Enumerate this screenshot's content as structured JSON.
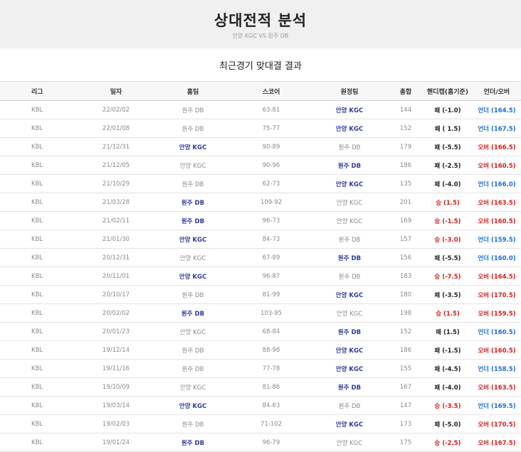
{
  "header": {
    "title": "상대전적 분석",
    "subtitle": "안양 KGC VS 원주 DB"
  },
  "section_title": "최근경기 맞대결 결과",
  "columns": [
    "리그",
    "일자",
    "홈팀",
    "스코어",
    "원정팀",
    "총합",
    "핸디캡(홈기준)",
    "언더/오버"
  ],
  "rows": [
    {
      "league": "KBL",
      "date": "22/02/02",
      "home": "원주 DB",
      "score": "63-81",
      "away": "안양 KGC",
      "total": "144",
      "handicap": "패 (-1.0)",
      "ou": "언더 (164.5)",
      "winner": "away",
      "hc": "l",
      "ou_type": "under"
    },
    {
      "league": "KBL",
      "date": "22/01/08",
      "home": "원주 DB",
      "score": "75-77",
      "away": "안양 KGC",
      "total": "152",
      "handicap": "패 ( 1.5)",
      "ou": "언더 (167.5)",
      "winner": "away",
      "hc": "l",
      "ou_type": "under"
    },
    {
      "league": "KBL",
      "date": "21/12/31",
      "home": "안양 KGC",
      "score": "90-89",
      "away": "원주 DB",
      "total": "179",
      "handicap": "패 (-5.5)",
      "ou": "오버 (166.5)",
      "winner": "home",
      "hc": "l",
      "ou_type": "over"
    },
    {
      "league": "KBL",
      "date": "21/12/05",
      "home": "안양 KGC",
      "score": "90-96",
      "away": "원주 DB",
      "total": "186",
      "handicap": "패 (-2.5)",
      "ou": "오버 (160.5)",
      "winner": "away",
      "hc": "l",
      "ou_type": "over"
    },
    {
      "league": "KBL",
      "date": "21/10/29",
      "home": "원주 DB",
      "score": "62-73",
      "away": "안양 KGC",
      "total": "135",
      "handicap": "패 (-4.0)",
      "ou": "언더 (166.0)",
      "winner": "away",
      "hc": "l",
      "ou_type": "under"
    },
    {
      "league": "KBL",
      "date": "21/03/28",
      "home": "원주 DB",
      "score": "109-92",
      "away": "안양 KGC",
      "total": "201",
      "handicap": "승 (1.5)",
      "ou": "오버 (163.5)",
      "winner": "home",
      "hc": "w",
      "ou_type": "over"
    },
    {
      "league": "KBL",
      "date": "21/02/11",
      "home": "원주 DB",
      "score": "96-73",
      "away": "안양 KGC",
      "total": "169",
      "handicap": "승 (-1.5)",
      "ou": "오버 (160.5)",
      "winner": "home",
      "hc": "w",
      "ou_type": "over"
    },
    {
      "league": "KBL",
      "date": "21/01/30",
      "home": "안양 KGC",
      "score": "84-73",
      "away": "원주 DB",
      "total": "157",
      "handicap": "승 (-3.0)",
      "ou": "언더 (159.5)",
      "winner": "home",
      "hc": "w",
      "ou_type": "under"
    },
    {
      "league": "KBL",
      "date": "20/12/31",
      "home": "안양 KGC",
      "score": "67-89",
      "away": "원주 DB",
      "total": "156",
      "handicap": "패 (-5.5)",
      "ou": "언더 (160.0)",
      "winner": "away",
      "hc": "l",
      "ou_type": "under"
    },
    {
      "league": "KBL",
      "date": "20/11/01",
      "home": "안양 KGC",
      "score": "96-87",
      "away": "원주 DB",
      "total": "183",
      "handicap": "승 (-7.5)",
      "ou": "오버 (164.5)",
      "winner": "home",
      "hc": "w",
      "ou_type": "over"
    },
    {
      "league": "KBL",
      "date": "20/10/17",
      "home": "원주 DB",
      "score": "81-99",
      "away": "안양 KGC",
      "total": "180",
      "handicap": "패 (-3.5)",
      "ou": "오버 (170.5)",
      "winner": "away",
      "hc": "l",
      "ou_type": "over"
    },
    {
      "league": "KBL",
      "date": "20/02/02",
      "home": "원주 DB",
      "score": "103-95",
      "away": "안양 KGC",
      "total": "198",
      "handicap": "승 (1.5)",
      "ou": "오버 (159.5)",
      "winner": "home",
      "hc": "w",
      "ou_type": "over"
    },
    {
      "league": "KBL",
      "date": "20/01/23",
      "home": "안양 KGC",
      "score": "68-84",
      "away": "원주 DB",
      "total": "152",
      "handicap": "패 (1.5)",
      "ou": "언더 (160.5)",
      "winner": "away",
      "hc": "l",
      "ou_type": "under"
    },
    {
      "league": "KBL",
      "date": "19/12/14",
      "home": "원주 DB",
      "score": "88-98",
      "away": "안양 KGC",
      "total": "186",
      "handicap": "패 (-1.5)",
      "ou": "오버 (160.5)",
      "winner": "away",
      "hc": "l",
      "ou_type": "over"
    },
    {
      "league": "KBL",
      "date": "19/11/16",
      "home": "원주 DB",
      "score": "77-78",
      "away": "안양 KGC",
      "total": "155",
      "handicap": "패 (-4.5)",
      "ou": "언더 (158.5)",
      "winner": "away",
      "hc": "l",
      "ou_type": "under"
    },
    {
      "league": "KBL",
      "date": "19/10/09",
      "home": "안양 KGC",
      "score": "81-86",
      "away": "원주 DB",
      "total": "167",
      "handicap": "패 (-4.0)",
      "ou": "오버 (163.5)",
      "winner": "away",
      "hc": "l",
      "ou_type": "over"
    },
    {
      "league": "KBL",
      "date": "19/03/14",
      "home": "안양 KGC",
      "score": "84-63",
      "away": "원주 DB",
      "total": "147",
      "handicap": "승 (-3.5)",
      "ou": "언더 (169.5)",
      "winner": "home",
      "hc": "w",
      "ou_type": "under"
    },
    {
      "league": "KBL",
      "date": "19/02/03",
      "home": "원주 DB",
      "score": "71-102",
      "away": "안양 KGC",
      "total": "173",
      "handicap": "패 (-5.0)",
      "ou": "오버 (170.5)",
      "winner": "away",
      "hc": "l",
      "ou_type": "over"
    },
    {
      "league": "KBL",
      "date": "19/01/24",
      "home": "원주 DB",
      "score": "96-79",
      "away": "안양 KGC",
      "total": "175",
      "handicap": "승 (-2.5)",
      "ou": "오버 (167.5)",
      "winner": "home",
      "hc": "w",
      "ou_type": "over"
    }
  ]
}
